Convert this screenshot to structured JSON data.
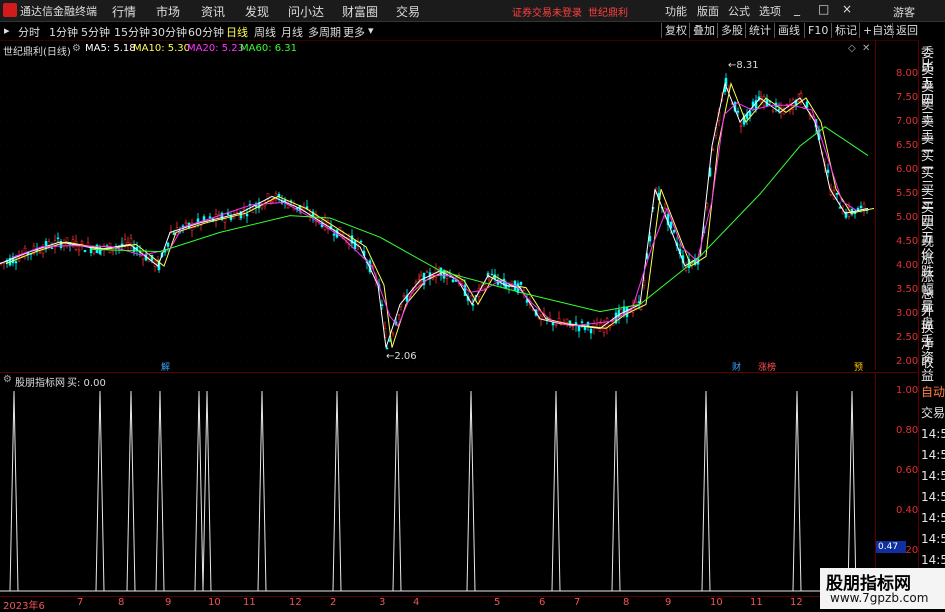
{
  "app": {
    "title": "通达信金融终端"
  },
  "menu": [
    "行情",
    "市场",
    "资讯",
    "发现",
    "问小达",
    "财富圈",
    "交易"
  ],
  "notice": {
    "left": "证券交易未登录",
    "right": "世纪鼎利"
  },
  "tools": [
    "功能",
    "版面",
    "公式",
    "选项"
  ],
  "window_buttons": [
    "_",
    "□",
    "×"
  ],
  "user": "游客",
  "period_tabs": [
    "分时",
    "1分钟",
    "5分钟",
    "15分钟",
    "30分钟",
    "60分钟",
    "日线",
    "周线",
    "月线",
    "多周期",
    "更多"
  ],
  "active_tab": "日线",
  "right_buttons": [
    "复权",
    "叠加",
    "多股",
    "统计",
    "画线",
    "F10",
    "标记",
    "+自选",
    "返回"
  ],
  "stock": {
    "name": "世纪鼎利(日线)"
  },
  "ma_legend": [
    {
      "label": "MA5: 5.18",
      "color": "#ffffff"
    },
    {
      "label": "MA10: 5.30",
      "color": "#ffff54"
    },
    {
      "label": "MA20: 5.23",
      "color": "#ff33ff"
    },
    {
      "label": "MA60: 6.31",
      "color": "#33ff33"
    }
  ],
  "price_axis": [
    "8.00",
    "7.50",
    "7.00",
    "6.50",
    "6.00",
    "5.50",
    "5.00",
    "4.50",
    "4.00",
    "3.50",
    "3.00",
    "2.50",
    "2.00"
  ],
  "annotations": {
    "high": "8.31",
    "low": "2.06"
  },
  "badges": [
    {
      "text": "解",
      "color": "#3fa0ff"
    },
    {
      "text": "财",
      "color": "#3fa0ff"
    },
    {
      "text": "涨榜",
      "color": "#ff5050"
    },
    {
      "text": "预",
      "color": "#ffcc00"
    }
  ],
  "sub_indicator": {
    "title": "股朋指标网",
    "value": "买: 0.00"
  },
  "sub_axis": [
    "1.00",
    "0.80",
    "0.60",
    "0.40",
    "0.20"
  ],
  "sub_marker": "0.47",
  "right_strip": [
    "委比",
    "卖五",
    "卖四",
    "卖三",
    "卖二",
    "卖一",
    "买一",
    "买二",
    "买三",
    "买四",
    "买五",
    "现价",
    "涨跌",
    "涨幅",
    "总量",
    "外盘",
    "换手",
    "净资",
    "收益"
  ],
  "right_strip_lower": [
    "自动",
    "交易",
    "14:5",
    "14:5",
    "14:5",
    "14:5",
    "14:5",
    "14:5",
    "14:5",
    "14:5",
    "14:5"
  ],
  "x_axis": [
    "2023年6",
    "7",
    "8",
    "9",
    "10",
    "11",
    "12",
    "2",
    "3",
    "4",
    "5",
    "6",
    "7",
    "8",
    "9",
    "10",
    "11",
    "12"
  ],
  "watermark": {
    "title": "股朋指标网",
    "url": "www.7gpzb.com"
  },
  "colors": {
    "up": "#ff3333",
    "down": "#00ffff",
    "axis": "#cc2222"
  }
}
